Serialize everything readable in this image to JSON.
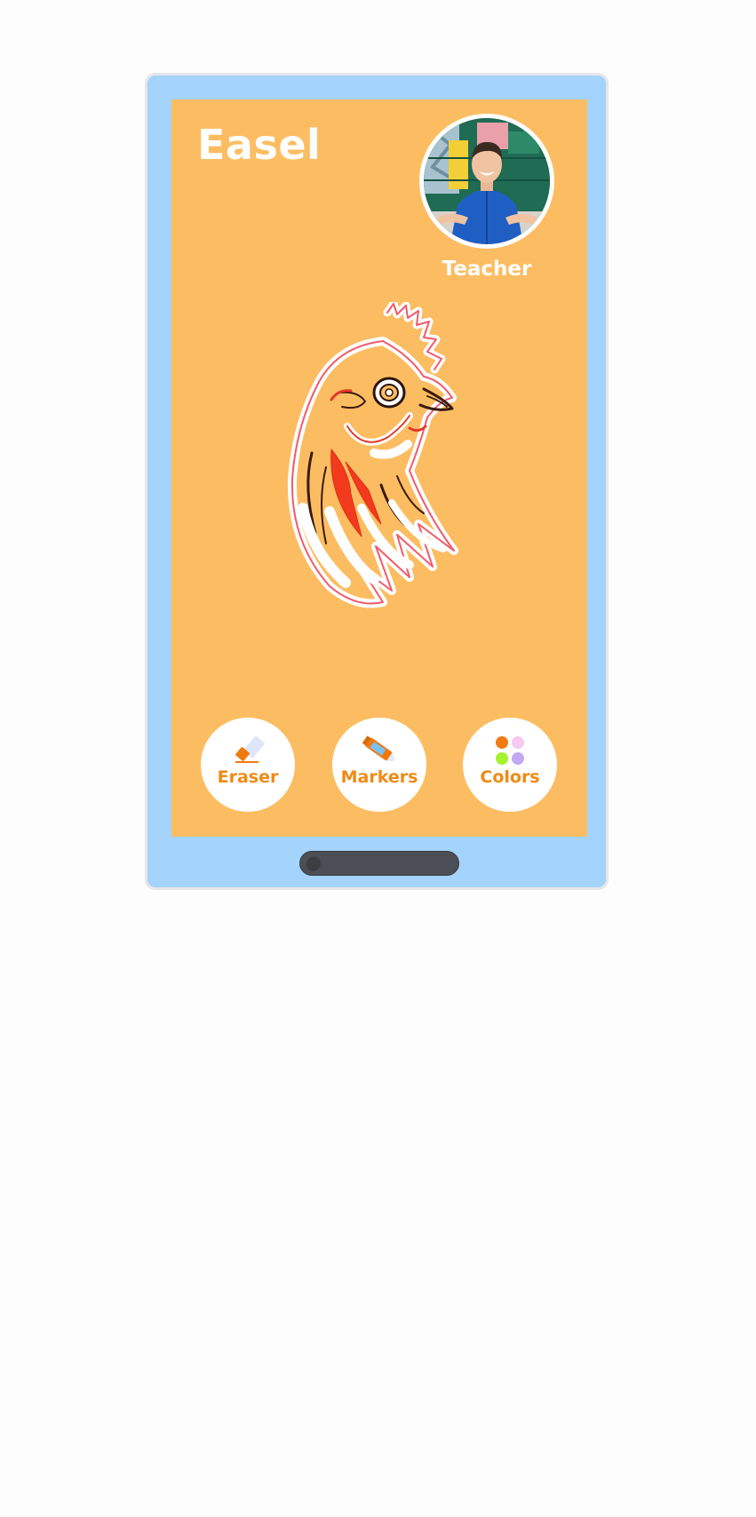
{
  "app": {
    "title": "Easel"
  },
  "teacher": {
    "label": "Teacher"
  },
  "tools": [
    {
      "label": "Eraser",
      "icon": "eraser-icon"
    },
    {
      "label": "Markers",
      "icon": "marker-icon"
    },
    {
      "label": "Colors",
      "icon": "color-palette-icon"
    }
  ],
  "palette": {
    "colors": [
      "#f47a16",
      "#f6c9f3",
      "#a5f22f",
      "#c2a9f5"
    ]
  },
  "theme": {
    "frame": "#a4d3fb",
    "canvas": "#fcbd62",
    "accent": "#f08a14"
  }
}
